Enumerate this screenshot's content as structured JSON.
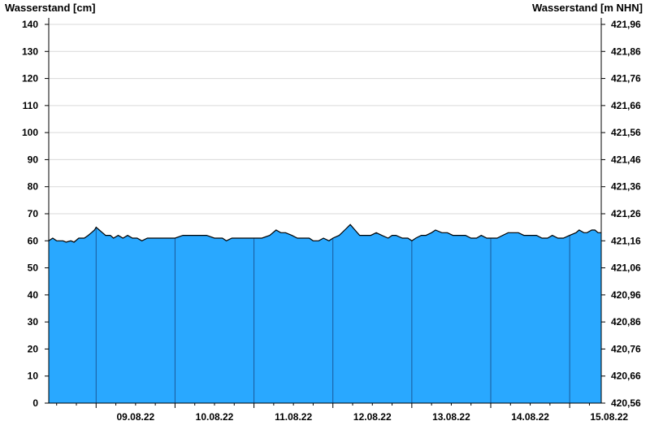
{
  "chart_data": {
    "type": "area",
    "left_axis_title": "Wasserstand [cm]",
    "right_axis_title": "Wasserstand [m NHN]",
    "ylim": [
      0,
      140
    ],
    "y_ticks": [
      0,
      10,
      20,
      30,
      40,
      50,
      60,
      70,
      80,
      90,
      100,
      110,
      120,
      130,
      140
    ],
    "right_ticks": [
      "420,56",
      "420,66",
      "420,76",
      "420,86",
      "420,96",
      "421,06",
      "421,16",
      "421,26",
      "421,36",
      "421,46",
      "421,56",
      "421,66",
      "421,76",
      "421,86",
      "421,96"
    ],
    "date_labels": [
      "09.08.22",
      "10.08.22",
      "11.08.22",
      "12.08.22",
      "13.08.22",
      "14.08.22",
      "15.08.22"
    ],
    "x_unit": "days since 08.08.22 00:00",
    "xlim": [
      0.4,
      7.4
    ],
    "grid": true,
    "fill_color": "#29a8ff",
    "line_color": "#000000",
    "day_separator_color": "#1a5a9a",
    "points": [
      [
        0.4,
        60
      ],
      [
        0.45,
        61
      ],
      [
        0.5,
        60
      ],
      [
        0.58,
        60
      ],
      [
        0.62,
        59.5
      ],
      [
        0.68,
        60
      ],
      [
        0.72,
        59.5
      ],
      [
        0.78,
        61
      ],
      [
        0.85,
        61
      ],
      [
        0.9,
        62
      ],
      [
        0.94,
        63
      ],
      [
        0.98,
        64
      ],
      [
        1.0,
        65
      ],
      [
        1.04,
        64
      ],
      [
        1.08,
        63
      ],
      [
        1.12,
        62
      ],
      [
        1.18,
        62
      ],
      [
        1.22,
        61
      ],
      [
        1.28,
        62
      ],
      [
        1.34,
        61
      ],
      [
        1.4,
        62
      ],
      [
        1.46,
        61
      ],
      [
        1.52,
        61
      ],
      [
        1.58,
        60
      ],
      [
        1.65,
        61
      ],
      [
        1.8,
        61
      ],
      [
        1.9,
        61
      ],
      [
        2.0,
        61
      ],
      [
        2.1,
        62
      ],
      [
        2.2,
        62
      ],
      [
        2.3,
        62
      ],
      [
        2.4,
        62
      ],
      [
        2.5,
        61
      ],
      [
        2.6,
        61
      ],
      [
        2.65,
        60
      ],
      [
        2.72,
        61
      ],
      [
        2.8,
        61
      ],
      [
        2.9,
        61
      ],
      [
        3.0,
        61
      ],
      [
        3.1,
        61
      ],
      [
        3.2,
        62
      ],
      [
        3.28,
        64
      ],
      [
        3.34,
        63
      ],
      [
        3.4,
        63
      ],
      [
        3.48,
        62
      ],
      [
        3.55,
        61
      ],
      [
        3.62,
        61
      ],
      [
        3.7,
        61
      ],
      [
        3.75,
        60
      ],
      [
        3.82,
        60
      ],
      [
        3.88,
        61
      ],
      [
        3.95,
        60
      ],
      [
        4.0,
        61
      ],
      [
        4.08,
        62
      ],
      [
        4.15,
        64
      ],
      [
        4.22,
        66
      ],
      [
        4.28,
        64
      ],
      [
        4.34,
        62
      ],
      [
        4.4,
        62
      ],
      [
        4.48,
        62
      ],
      [
        4.55,
        63
      ],
      [
        4.62,
        62
      ],
      [
        4.7,
        61
      ],
      [
        4.75,
        62
      ],
      [
        4.8,
        62
      ],
      [
        4.88,
        61
      ],
      [
        4.95,
        61
      ],
      [
        5.0,
        60
      ],
      [
        5.05,
        61
      ],
      [
        5.12,
        62
      ],
      [
        5.18,
        62
      ],
      [
        5.25,
        63
      ],
      [
        5.3,
        64
      ],
      [
        5.38,
        63
      ],
      [
        5.45,
        63
      ],
      [
        5.52,
        62
      ],
      [
        5.6,
        62
      ],
      [
        5.68,
        62
      ],
      [
        5.75,
        61
      ],
      [
        5.82,
        61
      ],
      [
        5.88,
        62
      ],
      [
        5.95,
        61
      ],
      [
        6.0,
        61
      ],
      [
        6.08,
        61
      ],
      [
        6.15,
        62
      ],
      [
        6.22,
        63
      ],
      [
        6.28,
        63
      ],
      [
        6.35,
        63
      ],
      [
        6.42,
        62
      ],
      [
        6.5,
        62
      ],
      [
        6.58,
        62
      ],
      [
        6.65,
        61
      ],
      [
        6.72,
        61
      ],
      [
        6.78,
        62
      ],
      [
        6.85,
        61
      ],
      [
        6.92,
        61
      ],
      [
        7.0,
        62
      ],
      [
        7.08,
        63
      ],
      [
        7.12,
        64
      ],
      [
        7.18,
        63
      ],
      [
        7.22,
        63
      ],
      [
        7.28,
        64
      ],
      [
        7.32,
        64
      ],
      [
        7.36,
        63
      ],
      [
        7.4,
        63
      ]
    ]
  }
}
